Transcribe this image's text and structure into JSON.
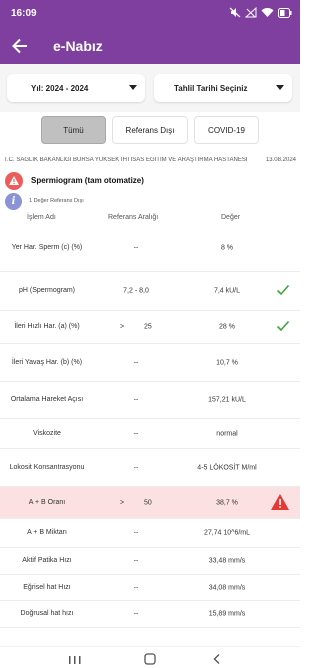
{
  "status_bar": {
    "time": "16:09",
    "battery_level": "50%"
  },
  "app_bar": {
    "title": "e-Nabız",
    "back_icon": "arrow-left-icon",
    "background_color": "#7e3f9e"
  },
  "filters": {
    "year_label": "Yıl:  2024 - 2024",
    "date_label": "Tahlil Tarihi Seçiniz"
  },
  "tabs": [
    {
      "label": "Tümü",
      "selected": true
    },
    {
      "label": "Referans Dışı",
      "selected": false
    },
    {
      "label": "COVID-19",
      "selected": false
    }
  ],
  "institution": {
    "name": "T.C. SAĞLIK BAKANLIĞI BURSA YÜKSEK İHTİSAS EĞİTİM VE ARAŞTIRMA HASTANESİ",
    "date": "13.08.2024"
  },
  "section": {
    "title": "Spermiogram (tam otomatize)",
    "info": "1 Değer Referans Dışı"
  },
  "table": {
    "headers": [
      "İşlem Adı",
      "Referans Aralığı",
      "Değer"
    ],
    "rows": [
      {
        "name": "Yer Har. Sperm (c) (%)",
        "reference": "--",
        "value": "8 %",
        "status": "none"
      },
      {
        "name": "pH (Spermogram)",
        "reference": "7,2 - 8,0",
        "value": "7,4 kU/L",
        "status": "ok"
      },
      {
        "name": "İleri Hızlı Har. (a) (%)",
        "ref_operator": ">",
        "ref_value": "25",
        "value": "28 %",
        "status": "ok"
      },
      {
        "name": "İleri Yavaş Har. (b) (%)",
        "reference": "--",
        "value": "10,7 %",
        "status": "none"
      },
      {
        "name": "Ortalama Hareket Açısı",
        "reference": "--",
        "value": "157,21 kU/L",
        "status": "none"
      },
      {
        "name": "Viskozite",
        "reference": "--",
        "value": "normal",
        "status": "none"
      },
      {
        "name": "Lokosit Konsantrasyonu",
        "reference": "--",
        "value": "4-5 LÖKOSİT M/ml",
        "status": "none"
      },
      {
        "name": "A + B Oranı",
        "ref_operator": ">",
        "ref_value": "50",
        "value": "38,7 %",
        "status": "alert"
      },
      {
        "name": "A + B Miktarı",
        "reference": "--",
        "value": "27,74 10^6/mL",
        "status": "none"
      },
      {
        "name": "Aktif Patika Hızı",
        "reference": "--",
        "value": "33,48 mm/s",
        "status": "none"
      },
      {
        "name": "Eğrisel hat Hızı",
        "reference": "--",
        "value": "34,08 mm/s",
        "status": "none"
      },
      {
        "name": "Doğrusal hat hızı",
        "reference": "--",
        "value": "15,89 mm/s",
        "status": "none"
      }
    ]
  },
  "colors": {
    "ok_check": "#3ca63c",
    "alert_icon": "#e53935",
    "alert_row": "#fbe1e1"
  }
}
